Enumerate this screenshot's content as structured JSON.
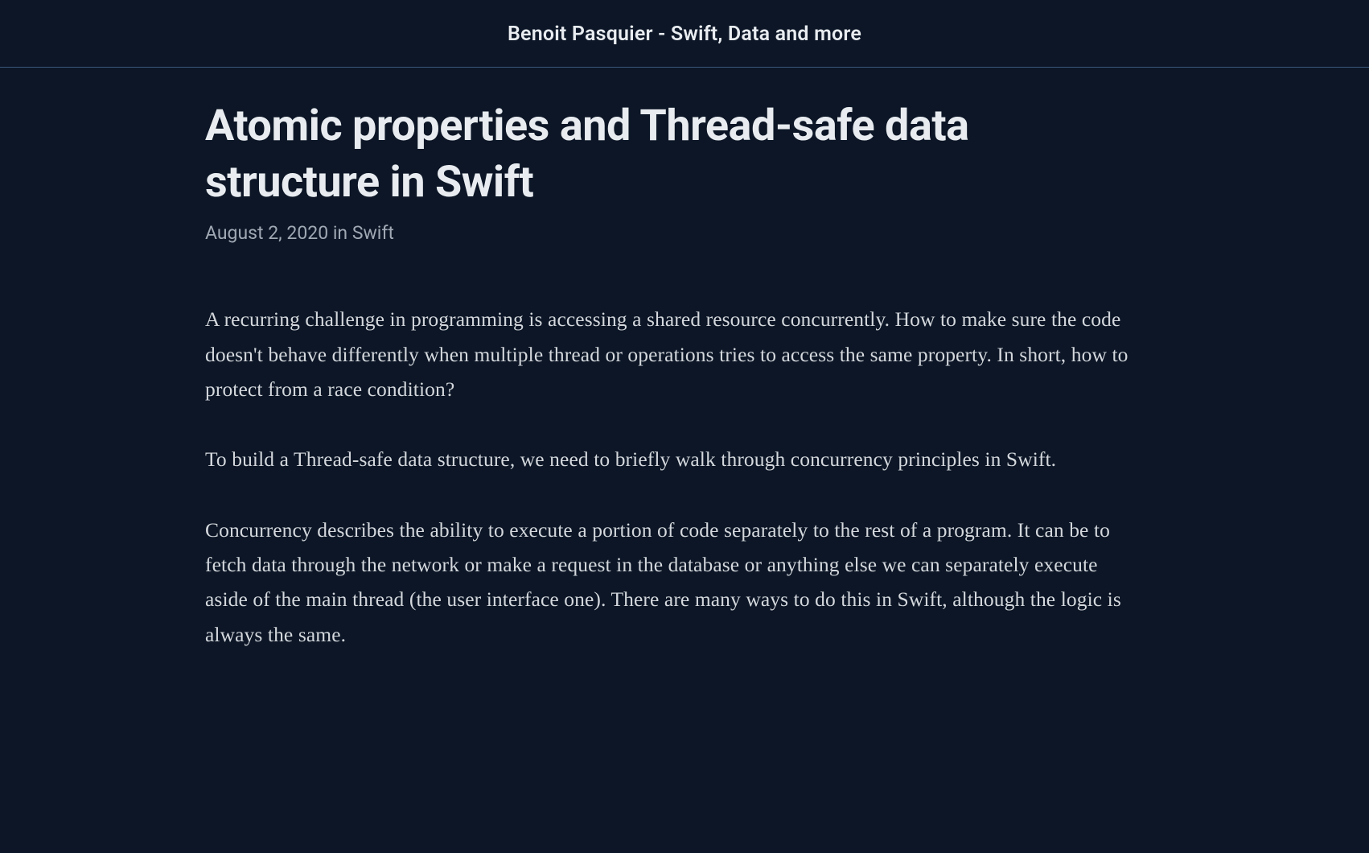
{
  "header": {
    "site_title": "Benoit Pasquier - Swift, Data and more"
  },
  "article": {
    "title": "Atomic properties and Thread-safe data structure in Swift",
    "date": "August 2, 2020",
    "meta_separator": " in ",
    "category": "Swift",
    "paragraphs": [
      "A recurring challenge in programming is accessing a shared resource concurrently. How to make sure the code doesn't behave differently when multiple thread or operations tries to access the same property. In short, how to protect from a race condition?",
      "To build a Thread-safe data structure, we need to briefly walk through concurrency principles in Swift.",
      "Concurrency describes the ability to execute a portion of code separately to the rest of a program. It can be to fetch data through the network or make a request in the database or anything else we can separately execute aside of the main thread (the user interface one). There are many ways to do this in Swift, although the logic is always the same."
    ]
  }
}
